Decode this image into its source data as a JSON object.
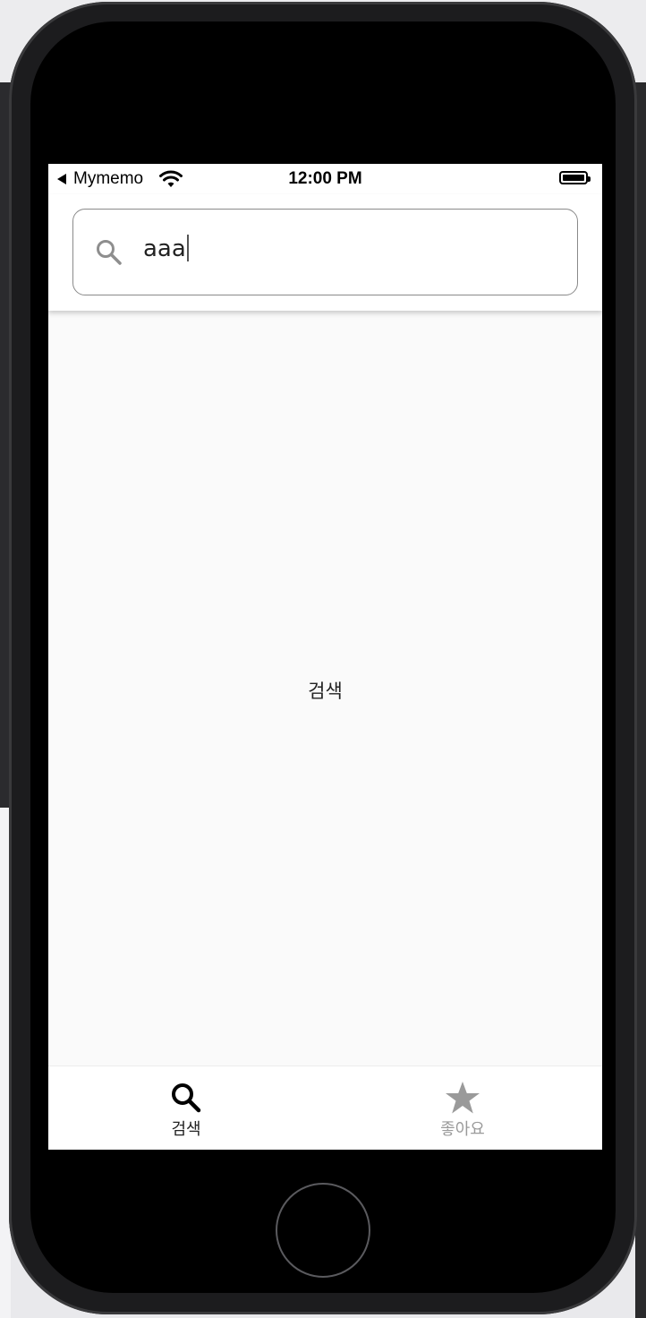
{
  "status_bar": {
    "back_app": "Mymemo",
    "time": "12:00 PM"
  },
  "search": {
    "value": "aaa"
  },
  "main": {
    "center_text": "검색"
  },
  "bottom_nav": {
    "items": [
      {
        "label": "검색",
        "icon": "search-icon",
        "active": true
      },
      {
        "label": "좋아요",
        "icon": "star-icon",
        "active": false
      }
    ]
  },
  "colors": {
    "active": "#000000",
    "inactive": "#9a9a9a",
    "screen_bg": "#fafafa"
  }
}
